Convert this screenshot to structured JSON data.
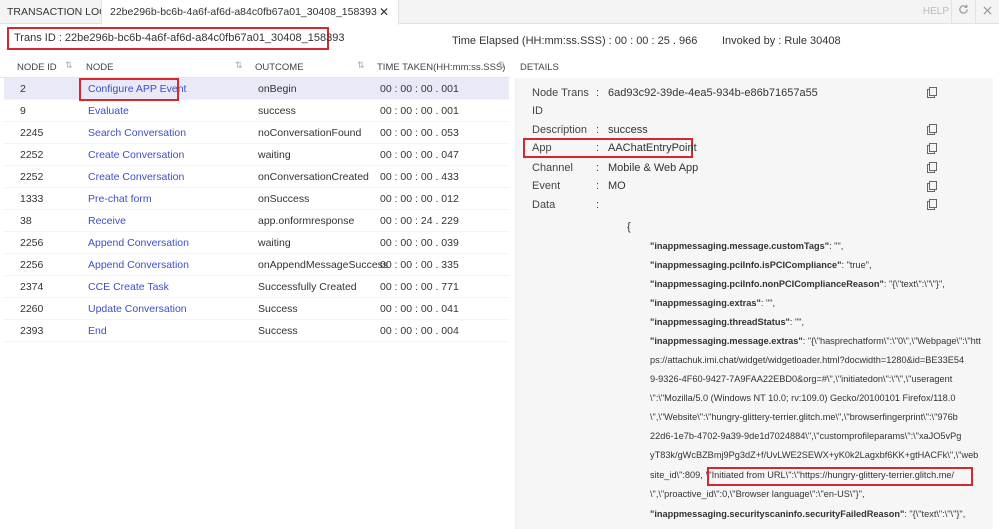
{
  "tabs": {
    "title": "TRANSACTION LOGS",
    "active": "22be296b-bc6b-4a6f-af6d-a84c0fb67a01_30408_158393",
    "close": "✕",
    "help": "HELP",
    "refresh_icon": "refresh-icon",
    "close_icon": "close-icon"
  },
  "info": {
    "trans_id": "Trans ID : 22be296b-bc6b-4a6f-af6d-a84c0fb67a01_30408_158393",
    "elapsed": "Time Elapsed (HH:mm:ss.SSS) :  00 : 00 : 25 . 966",
    "invoked": "Invoked by : Rule 30408"
  },
  "table": {
    "headers": {
      "node_id": "NODE ID",
      "node": "NODE",
      "outcome": "OUTCOME",
      "time": "TIME TAKEN(HH:mm:ss.SSS)"
    },
    "rows": [
      {
        "id": "2",
        "node": "Configure APP Event",
        "outcome": "onBegin",
        "time": "00 : 00 : 00 . 001"
      },
      {
        "id": "9",
        "node": "Evaluate",
        "outcome": "success",
        "time": "00 : 00 : 00 . 001"
      },
      {
        "id": "2245",
        "node": "Search Conversation",
        "outcome": "noConversationFound",
        "time": "00 : 00 : 00 . 053"
      },
      {
        "id": "2252",
        "node": "Create Conversation",
        "outcome": "waiting",
        "time": "00 : 00 : 00 . 047"
      },
      {
        "id": "2252",
        "node": "Create Conversation",
        "outcome": "onConversationCreated",
        "time": "00 : 00 : 00 . 433"
      },
      {
        "id": "1333",
        "node": "Pre-chat form",
        "outcome": "onSuccess",
        "time": "00 : 00 : 00 . 012"
      },
      {
        "id": "38",
        "node": "Receive",
        "outcome": "app.onformresponse",
        "time": "00 : 00 : 24 . 229"
      },
      {
        "id": "2256",
        "node": "Append Conversation",
        "outcome": "waiting",
        "time": "00 : 00 : 00 . 039"
      },
      {
        "id": "2256",
        "node": "Append Conversation",
        "outcome": "onAppendMessageSuccess",
        "time": "00 : 00 : 00 . 335"
      },
      {
        "id": "2374",
        "node": "CCE Create Task",
        "outcome": "Successfully Created",
        "time": "00 : 00 : 00 . 771"
      },
      {
        "id": "2260",
        "node": "Update Conversation",
        "outcome": "Success",
        "time": "00 : 00 : 00 . 041"
      },
      {
        "id": "2393",
        "node": "End",
        "outcome": "Success",
        "time": "00 : 00 : 00 . 004"
      }
    ]
  },
  "details": {
    "title": "DETAILS",
    "colon": ":",
    "node_trans_label_1": "Node Trans",
    "node_trans_label_2": "ID",
    "node_trans_value": "6ad93c92-39de-4ea5-934b-e86b71657a55",
    "description_label": "Description",
    "description_value": "success",
    "app_label": "App",
    "app_value": "AAChatEntryPoint",
    "channel_label": "Channel",
    "channel_value": "Mobile & Web App",
    "event_label": "Event",
    "event_value": "MO",
    "data_label": "Data",
    "json_open": "{",
    "json": {
      "l1k": "\"inappmessaging.message.customTags\"",
      "l1v": ": \"\",",
      "l2k": "\"inappmessaging.pciInfo.isPCICompliance\"",
      "l2v": ": \"true\",",
      "l3k": "\"inappmessaging.pciInfo.nonPCIComplianceReason\"",
      "l3v": ": \"{\\\"text\\\":\\\"\\\"}\",",
      "l4k": "\"inappmessaging.extras\"",
      "l4v": ": \"\",",
      "l5k": "\"inappmessaging.threadStatus\"",
      "l5v": ": \"\",",
      "l6k": "\"inappmessaging.message.extras\"",
      "l6v": ": \"{\\\"hasprechatform\\\":\\\"0\\\",\\\"Webpage\\\":\\\"htt",
      "l7": "ps://attachuk.imi.chat/widget/widgetloader.html?docwidth=1280&id=BE33E54",
      "l8": "9-9326-4F60-9427-7A9FAA22EBD0&org=#\\\",\\\"initiatedon\\\":\\\"\\\",\\\"useragent",
      "l9": "\\\":\\\"Mozilla/5.0 (Windows NT 10.0; rv:109.0) Gecko/20100101 Firefox/118.0",
      "l10": "\\\",\\\"Website\\\":\\\"hungry-glittery-terrier.glitch.me\\\",\\\"browserfingerprint\\\":\\\"976b",
      "l11": "22d6-1e7b-4702-9a39-9de1d7024884\\\",\\\"customprofileparams\\\":\\\"xaJO5vPg",
      "l12": "yT83k/gWcBZBmj9Pg3dZ+f/UvLWE2SEWX+yK0k2Lagxbf6KK+gtHACFk\\\",\\\"web",
      "l13a": "site_id\\\":809,",
      "l13b": "\\\"Initiated from URL\\\":\\\"https://hungry-glittery-terrier.glitch.me/",
      "l14": "\\\",\\\"proactive_id\\\":0,\\\"Browser language\\\":\\\"en-US\\\"}\",",
      "l15k": "\"inappmessaging.securityscaninfo.securityFailedReason\"",
      "l15v": ": \"{\\\"text\\\":\\\"\\\"}\","
    }
  }
}
